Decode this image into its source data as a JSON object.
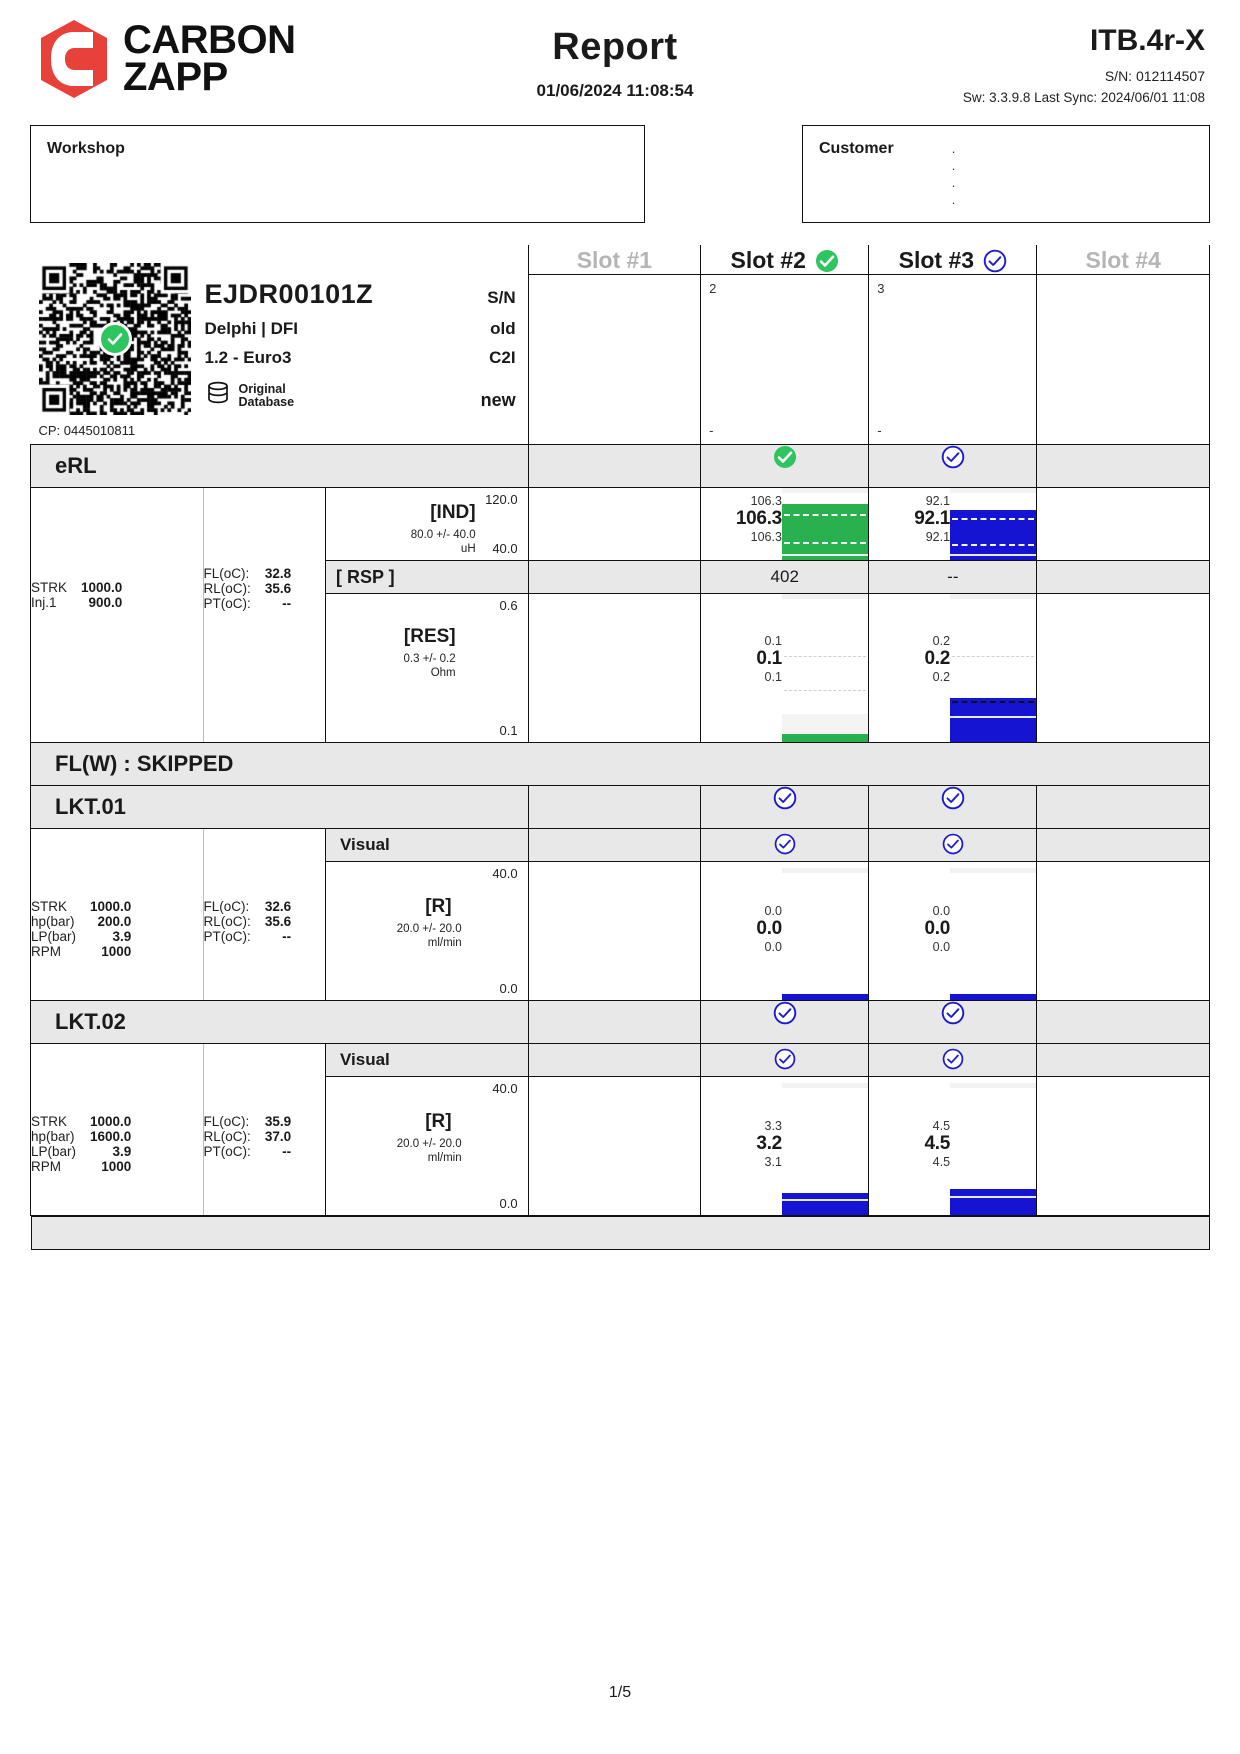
{
  "header": {
    "brand_line1": "CARBON",
    "brand_line2": "ZAPP",
    "logo_icon": "carbon-zapp-logo",
    "title": "Report",
    "datetime": "01/06/2024 11:08:54",
    "device_model": "ITB.4r-X",
    "device_sn": "S/N: 012114507",
    "device_sw": "Sw: 3.3.9.8 Last Sync: 2024/06/01 11:08"
  },
  "workshop": {
    "label": "Workshop",
    "value": ""
  },
  "customer": {
    "label": "Customer",
    "lines": [
      ".",
      ".",
      ".",
      "."
    ]
  },
  "injector": {
    "code": "EJDR00101Z",
    "sn_label": "S/N",
    "maker": "Delphi | DFI",
    "condition": "old",
    "spec": "1.2 - Euro3",
    "family": "C2I",
    "database": "Original\nDatabase",
    "database_line1": "Original",
    "database_line2": "Database",
    "state": "new",
    "cp": "CP: 0445010811",
    "qr_badge": "pass-check-icon"
  },
  "slots": [
    {
      "label": "Slot #1",
      "active": false,
      "status": "",
      "sn": "",
      "dash": ""
    },
    {
      "label": "Slot #2",
      "active": true,
      "status": "green-check-icon",
      "sn": "2",
      "dash": "-"
    },
    {
      "label": "Slot #3",
      "active": true,
      "status": "blue-check-icon",
      "sn": "3",
      "dash": "-"
    },
    {
      "label": "Slot #4",
      "active": false,
      "status": "",
      "sn": "",
      "dash": ""
    }
  ],
  "colors": {
    "green": "#2ab14f",
    "blue": "#1414d2",
    "grey_bar": "#e8e8e8",
    "dim_text": "#b5b5b5",
    "red_logo": "#e8413a"
  },
  "sections": [
    {
      "id": "erl",
      "title": "eRL",
      "status_slot2": "green-check-icon",
      "status_slot3": "blue-check-icon",
      "left_params": [
        {
          "k": "STRK",
          "v": "1000.0"
        },
        {
          "k": "Inj.1",
          "v": "900.0"
        }
      ],
      "temp_params": [
        {
          "k": "FL(oC):",
          "v": "32.8"
        },
        {
          "k": "RL(oC):",
          "v": "35.6"
        },
        {
          "k": "PT(oC):",
          "v": "--"
        }
      ],
      "rows": [
        {
          "type": "graph",
          "name": "[IND]",
          "tolerance": "80.0 +/- 40.0",
          "unit": "uH",
          "axis_top": "120.0",
          "axis_bottom": "40.0",
          "slot2": {
            "hi": "106.3",
            "mid": "106.3",
            "lo": "106.3"
          },
          "slot3": {
            "hi": "92.1",
            "mid": "92.1",
            "lo": "92.1"
          }
        },
        {
          "type": "bar",
          "name": "[ RSP ]",
          "slot2": "402",
          "slot3": "--"
        },
        {
          "type": "graph",
          "name": "[RES]",
          "tolerance": "0.3 +/- 0.2",
          "unit": "Ohm",
          "axis_top": "0.6",
          "axis_bottom": "0.1",
          "slot2": {
            "hi": "0.1",
            "mid": "0.1",
            "lo": "0.1"
          },
          "slot3": {
            "hi": "0.2",
            "mid": "0.2",
            "lo": "0.2"
          }
        }
      ]
    },
    {
      "id": "flw",
      "title": "FL(W) : SKIPPED"
    },
    {
      "id": "lkt01",
      "title": "LKT.01",
      "status_slot2": "blue-check-icon",
      "status_slot3": "blue-check-icon",
      "sub_title": "Visual",
      "sub_status_slot2": "blue-check-icon",
      "sub_status_slot3": "blue-check-icon",
      "left_params": [
        {
          "k": "STRK",
          "v": "1000.0"
        },
        {
          "k": "hp(bar)",
          "v": "200.0"
        },
        {
          "k": "LP(bar)",
          "v": "3.9"
        },
        {
          "k": "RPM",
          "v": "1000"
        }
      ],
      "temp_params": [
        {
          "k": "FL(oC):",
          "v": "32.6"
        },
        {
          "k": "RL(oC):",
          "v": "35.6"
        },
        {
          "k": "PT(oC):",
          "v": "--"
        }
      ],
      "rows": [
        {
          "type": "graph",
          "name": "[R]",
          "tolerance": "20.0 +/- 20.0",
          "unit": "ml/min",
          "axis_top": "40.0",
          "axis_bottom": "0.0",
          "slot2": {
            "hi": "0.0",
            "mid": "0.0",
            "lo": "0.0"
          },
          "slot3": {
            "hi": "0.0",
            "mid": "0.0",
            "lo": "0.0"
          }
        }
      ]
    },
    {
      "id": "lkt02",
      "title": "LKT.02",
      "status_slot2": "blue-check-icon",
      "status_slot3": "blue-check-icon",
      "sub_title": "Visual",
      "sub_status_slot2": "blue-check-icon",
      "sub_status_slot3": "blue-check-icon",
      "left_params": [
        {
          "k": "STRK",
          "v": "1000.0"
        },
        {
          "k": "hp(bar)",
          "v": "1600.0"
        },
        {
          "k": "LP(bar)",
          "v": "3.9"
        },
        {
          "k": "RPM",
          "v": "1000"
        }
      ],
      "temp_params": [
        {
          "k": "FL(oC):",
          "v": "35.9"
        },
        {
          "k": "RL(oC):",
          "v": "37.0"
        },
        {
          "k": "PT(oC):",
          "v": "--"
        }
      ],
      "rows": [
        {
          "type": "graph",
          "name": "[R]",
          "tolerance": "20.0 +/- 20.0",
          "unit": "ml/min",
          "axis_top": "40.0",
          "axis_bottom": "0.0",
          "slot2": {
            "hi": "3.3",
            "mid": "3.2",
            "lo": "3.1"
          },
          "slot3": {
            "hi": "4.5",
            "mid": "4.5",
            "lo": "4.5"
          }
        }
      ]
    }
  ],
  "footer": {
    "page": "1/5"
  }
}
